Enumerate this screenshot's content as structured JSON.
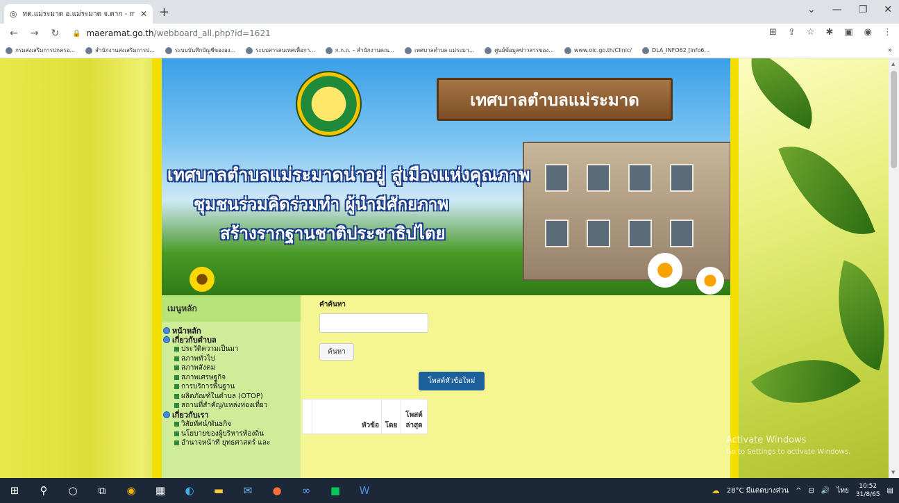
{
  "browser": {
    "tab_title": "ทต.แม่ระมาด อ.แม่ระมาด จ.ตาก - mae",
    "url_host": "maeramat.go.th",
    "url_path": "/webboard_all.php?id=1621",
    "bookmarks": [
      "กรมส่งเสริมการปกครอ...",
      "สำนักงานส่งเสริมการป...",
      "ระบบบันทึกบัญชีขององ...",
      "ระบบสารสนเทศเพื่อกา...",
      "ก.ก.ถ. – สำนักงานคณ...",
      "เทศบาลตำบล แม่ระมา...",
      "ศูนย์ข้อมูลข่าวสารของ...",
      "www.oic.go.th/Clinic/",
      "DLA_INFO62 [info6..."
    ]
  },
  "banner": {
    "sign": "เทศบาลตำบลแม่ระมาด",
    "slogan_lines": [
      "เทศบาลตำบลแม่ระมาดน่าอยู่ สู่เมืองแห่งคุณภาพ",
      "ชุมชนร่วมคิดร่วมทำ ผู้นำมีศักยภาพ",
      "สร้างรากฐานชาติประชาธิปไตย"
    ]
  },
  "sidebar": {
    "header": "เมนูหลัก",
    "items": [
      {
        "label": "หน้าหลัก",
        "level": "top"
      },
      {
        "label": "เกี่ยวกับตำบล",
        "level": "top"
      },
      {
        "label": "ประวัติความเป็นมา",
        "level": "sub"
      },
      {
        "label": "สภาพทั่วไป",
        "level": "sub"
      },
      {
        "label": "สภาพสังคม",
        "level": "sub"
      },
      {
        "label": "สภาพเศรษฐกิจ",
        "level": "sub"
      },
      {
        "label": "การบริการพื้นฐาน",
        "level": "sub"
      },
      {
        "label": "ผลิตภัณฑ์ในตำบล (OTOP)",
        "level": "sub"
      },
      {
        "label": "สถานที่สำคัญ/แหล่งท่องเที่ยว",
        "level": "sub"
      },
      {
        "label": "เกี่ยวกับเรา",
        "level": "top"
      },
      {
        "label": "วิสัยทัศน์/พันธกิจ",
        "level": "sub"
      },
      {
        "label": "นโยบายของผู้บริหารท้องถิ่น",
        "level": "sub"
      },
      {
        "label": "อำนาจหน้าที่ ยุทธศาสตร์ และ",
        "level": "sub"
      }
    ]
  },
  "main": {
    "search_label": "คำค้นหา",
    "search_value": "",
    "search_button": "ค้นหา",
    "new_post_button": "โพสต์หัวข้อใหม่",
    "table_headers": [
      "หัวข้อ",
      "โดย",
      "โพสต์ล่าสุด"
    ]
  },
  "watermark": {
    "title": "Activate Windows",
    "subtitle": "Go to Settings to activate Windows."
  },
  "taskbar": {
    "weather": "28°C มีแดดบางส่วน",
    "language": "ไทย",
    "time": "10:52",
    "date": "31/8/65"
  }
}
